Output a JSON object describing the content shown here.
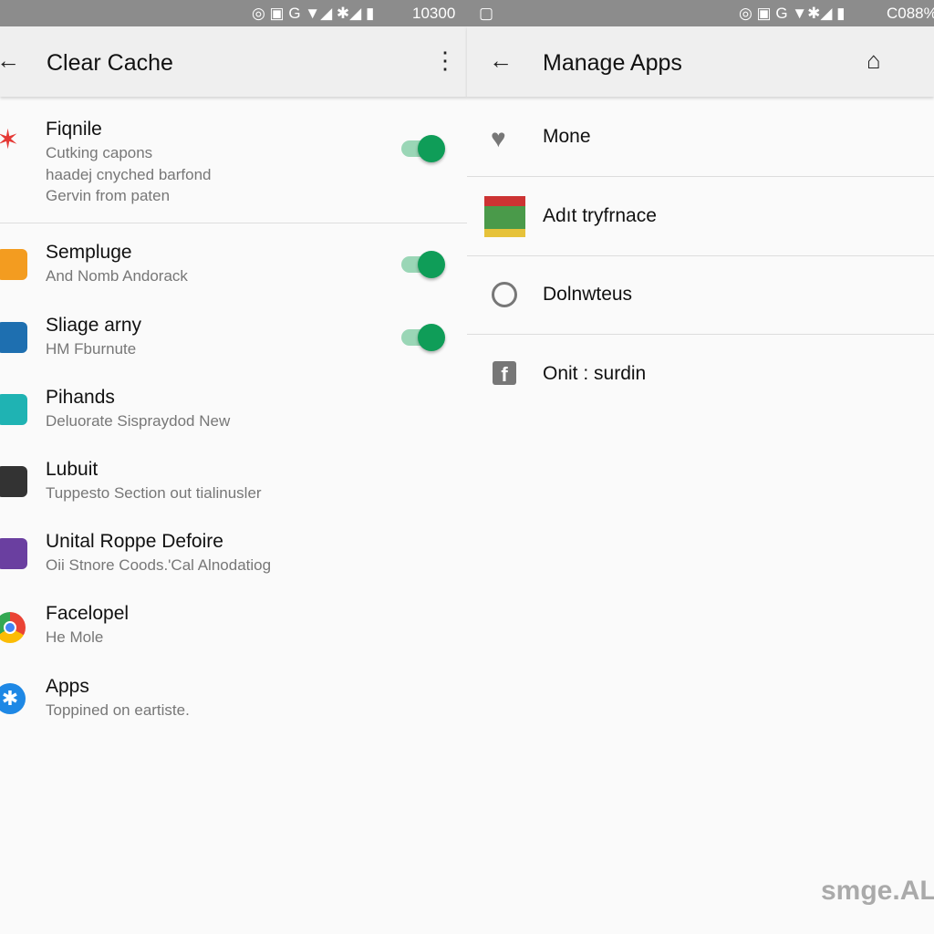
{
  "status_left": {
    "time": "10300"
  },
  "status_right": {
    "battery": "C088%"
  },
  "left": {
    "title": "Clear Cache",
    "items": [
      {
        "title": "Fiqnile",
        "subs": [
          "Cutking capons",
          "haadej cnyched barfond",
          "Gervin from paten"
        ],
        "toggle": true,
        "icon": "star-icon",
        "color": "#e53935"
      },
      {
        "title": "Sempluge",
        "subs": [
          "And Nomb Andorack"
        ],
        "toggle": true,
        "icon": "app-icon",
        "color": "#f39c20"
      },
      {
        "title": "Sliage arny",
        "subs": [
          "HM Fburnute"
        ],
        "toggle": true,
        "icon": "play-icon",
        "color": "#1e6fb0"
      },
      {
        "title": "Pihands",
        "subs": [
          "Deluorate Sispraydod New"
        ],
        "toggle": false,
        "icon": "app-icon",
        "color": "#1fb3b3"
      },
      {
        "title": "Lubuit",
        "subs": [
          "Tuppesto Section out tialinusler"
        ],
        "toggle": false,
        "icon": "camera-icon",
        "color": "#333"
      },
      {
        "title": "Unital Roppe Defoire",
        "subs": [
          "Oii Stnore Coods.'Cal Alnodatiog"
        ],
        "toggle": false,
        "icon": "app-icon",
        "color": "#6a3fa0"
      },
      {
        "title": "Facelopel",
        "subs": [
          "He Mole"
        ],
        "toggle": false,
        "icon": "chrome-icon",
        "color": "#4285f4"
      },
      {
        "title": "Apps",
        "subs": [
          "Toppined on eartiste."
        ],
        "toggle": false,
        "icon": "bluetooth-icon",
        "color": "#1e88e5"
      }
    ]
  },
  "right": {
    "title": "Manage Apps",
    "items": [
      {
        "label": "Mone",
        "icon": "wifi-heart-icon"
      },
      {
        "label": "Adıt tryfrnace",
        "icon": "game-icon"
      },
      {
        "label": "Dolnwteus",
        "icon": "clock-icon"
      },
      {
        "label": "Onit : surdin",
        "icon": "facebook-icon"
      }
    ]
  },
  "watermark": "smge.ALF",
  "accent": "#0f9d58"
}
